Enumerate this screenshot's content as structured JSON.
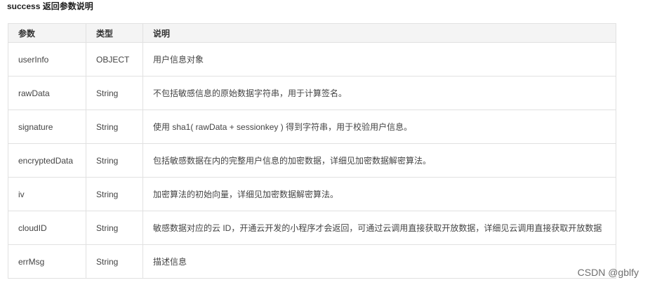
{
  "section": {
    "title": "success 返回参数说明"
  },
  "table": {
    "headers": [
      "参数",
      "类型",
      "说明"
    ],
    "rows": [
      [
        "userInfo",
        "OBJECT",
        "用户信息对象"
      ],
      [
        "rawData",
        "String",
        "不包括敏感信息的原始数据字符串，用于计算签名。"
      ],
      [
        "signature",
        "String",
        "使用 sha1( rawData + sessionkey ) 得到字符串，用于校验用户信息。"
      ],
      [
        "encryptedData",
        "String",
        "包括敏感数据在内的完整用户信息的加密数据，详细见加密数据解密算法。"
      ],
      [
        "iv",
        "String",
        "加密算法的初始向量，详细见加密数据解密算法。"
      ],
      [
        "cloudID",
        "String",
        "敏感数据对应的云 ID，开通云开发的小程序才会返回，可通过云调用直接获取开放数据，详细见云调用直接获取开放数据"
      ],
      [
        "errMsg",
        "String",
        "描述信息"
      ]
    ]
  },
  "watermark": "CSDN @gblfy"
}
